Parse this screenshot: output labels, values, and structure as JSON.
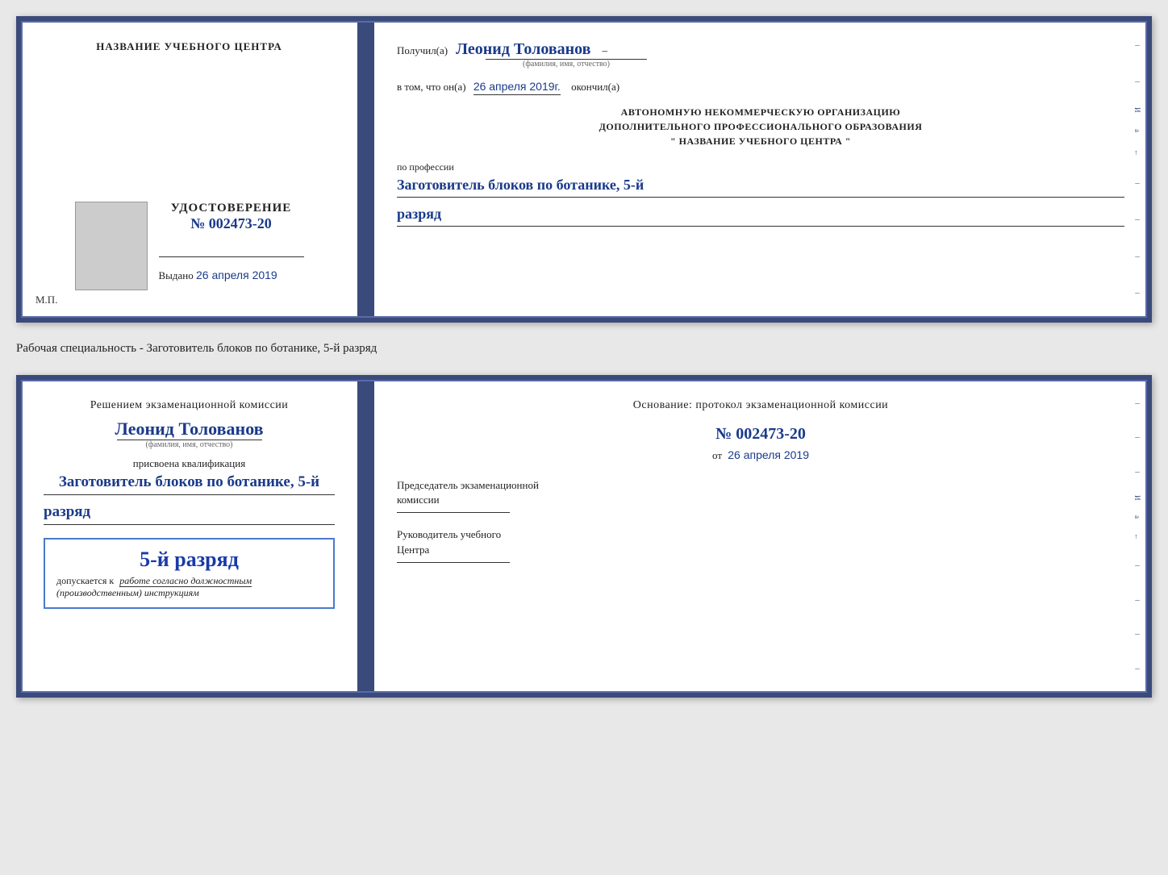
{
  "doc1": {
    "left": {
      "center_name_label": "НАЗВАНИЕ УЧЕБНОГО ЦЕНТРА",
      "cert_title": "УДОСТОВЕРЕНИЕ",
      "cert_number": "№ 002473-20",
      "issued_prefix": "Выдано",
      "issued_date": "26 апреля 2019",
      "mp_label": "М.П."
    },
    "right": {
      "received_prefix": "Получил(а)",
      "received_name": "Леонид Толованов",
      "fio_sub": "(фамилия, имя, отчество)",
      "confirm_text": "в том, что он(а)",
      "confirm_date": "26 апреля 2019г.",
      "confirm_suffix": "окончил(а)",
      "org_line1": "АВТОНОМНУЮ НЕКОММЕРЧЕСКУЮ ОРГАНИЗАЦИЮ",
      "org_line2": "ДОПОЛНИТЕЛЬНОГО ПРОФЕССИОНАЛЬНОГО ОБРАЗОВАНИЯ",
      "org_line3": "\"  НАЗВАНИЕ УЧЕБНОГО ЦЕНТРА  \"",
      "profession_prefix": "по профессии",
      "profession_value": "Заготовитель блоков по ботанике, 5-й",
      "rank_value": "разряд"
    }
  },
  "specialty_label": "Рабочая специальность - Заготовитель блоков по ботанике, 5-й разряд",
  "doc2": {
    "left": {
      "commission_line1": "Решением экзаменационной комиссии",
      "person_name": "Леонид Толованов",
      "fio_sub": "(фамилия, имя, отчество)",
      "qualification_prefix": "присвоена квалификация",
      "qualification_value": "Заготовитель блоков по ботанике, 5-й",
      "rank_value": "разряд",
      "rank_box_big": "5-й разряд",
      "allowed_prefix": "допускается к",
      "allowed_underline": "работе согласно должностным",
      "allowed_suffix": "(производственным) инструкциям"
    },
    "right": {
      "basis_title": "Основание: протокол экзаменационной комиссии",
      "protocol_number": "№  002473-20",
      "protocol_date_prefix": "от",
      "protocol_date": "26 апреля 2019",
      "chairman_title": "Председатель экзаменационной",
      "chairman_title2": "комиссии",
      "director_title": "Руководитель учебного",
      "director_title2": "Центра"
    }
  }
}
